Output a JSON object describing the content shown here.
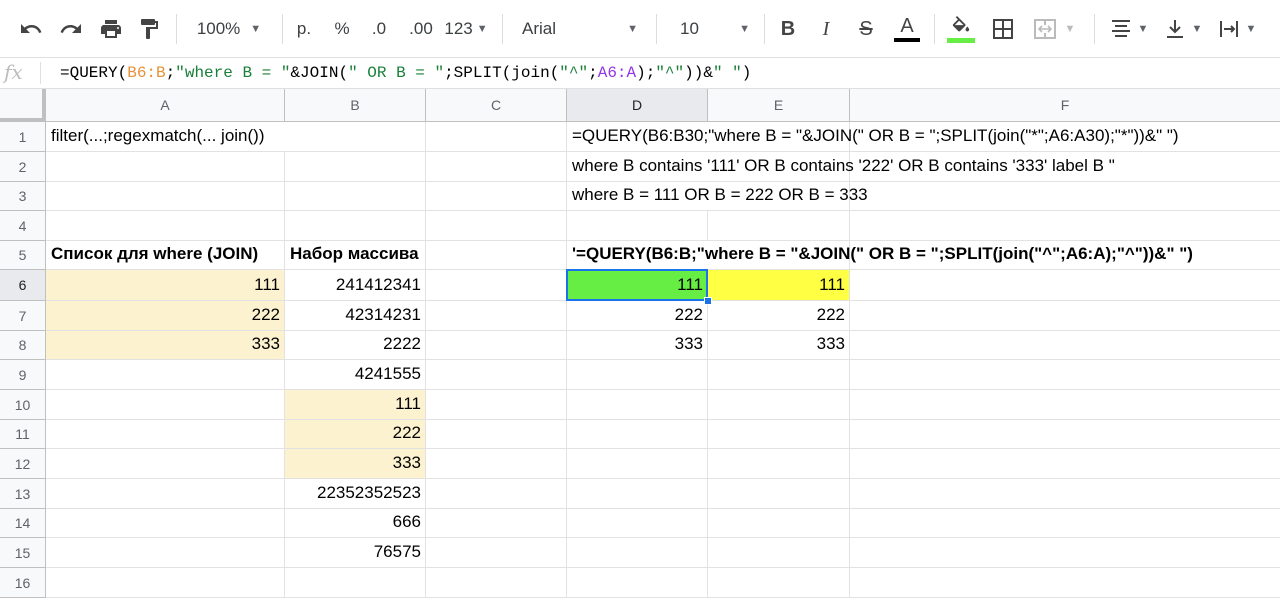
{
  "toolbar": {
    "zoom": "100%",
    "currency": "р.",
    "percent": "%",
    "decrease_decimals": ".0",
    "increase_decimals": ".00",
    "more_formats": "123",
    "font": "Arial",
    "font_size": "10",
    "bold": "B",
    "italic": "I",
    "strikethrough": "S",
    "text_color_letter": "A"
  },
  "formula_bar": {
    "fx": "fx",
    "formula": {
      "p1": "=QUERY(",
      "ref1": "B6:B",
      "p2": ";",
      "str1": "\"where B = \"",
      "p3": "&JOIN(",
      "str2": "\" OR B = \"",
      "p4": ";SPLIT(join(",
      "str3": "\"^\"",
      "p5": ";",
      "ref2": "A6:A",
      "p6": ");",
      "str4": "\"^\"",
      "p7": "))&",
      "str5": "\" \"",
      "p8": ")"
    }
  },
  "columns": [
    "A",
    "B",
    "C",
    "D",
    "E",
    "F"
  ],
  "rows": [
    "1",
    "2",
    "3",
    "4",
    "5",
    "6",
    "7",
    "8",
    "9",
    "10",
    "11",
    "12",
    "13",
    "14",
    "15",
    "16"
  ],
  "cells": {
    "A1": "filter(...;regexmatch(... join())",
    "D1": "=QUERY(B6:B30;\"where B = \"&JOIN(\" OR B = \";SPLIT(join(\"*\";A6:A30);\"*\"))&\" \")",
    "D2": "where B contains '111' OR B contains '222' OR B contains '333' label B \"",
    "D3": "where B = 111 OR B = 222 OR B = 333",
    "A5": "Список для where (JOIN)",
    "B5": "Набор массива",
    "D5": "'=QUERY(B6:B;\"where B = \"&JOIN(\" OR B = \";SPLIT(join(\"^\";A6:A);\"^\"))&\" \")",
    "A6": "111",
    "A7": "222",
    "A8": "333",
    "B6": "241412341",
    "B7": "42314231",
    "B8": "2222",
    "B9": "4241555",
    "B10": "111",
    "B11": "222",
    "B12": "333",
    "B13": "22352352523",
    "B14": "666",
    "B15": "76575",
    "D6": "111",
    "D7": "222",
    "D8": "333",
    "E6": "111",
    "E7": "222",
    "E8": "333"
  },
  "colors": {
    "highlight_tan": "#fdf2d0",
    "highlight_green": "#66ee44",
    "highlight_yellow": "#ffff44",
    "selection_blue": "#1a73e8"
  },
  "selected_cell": "D6"
}
